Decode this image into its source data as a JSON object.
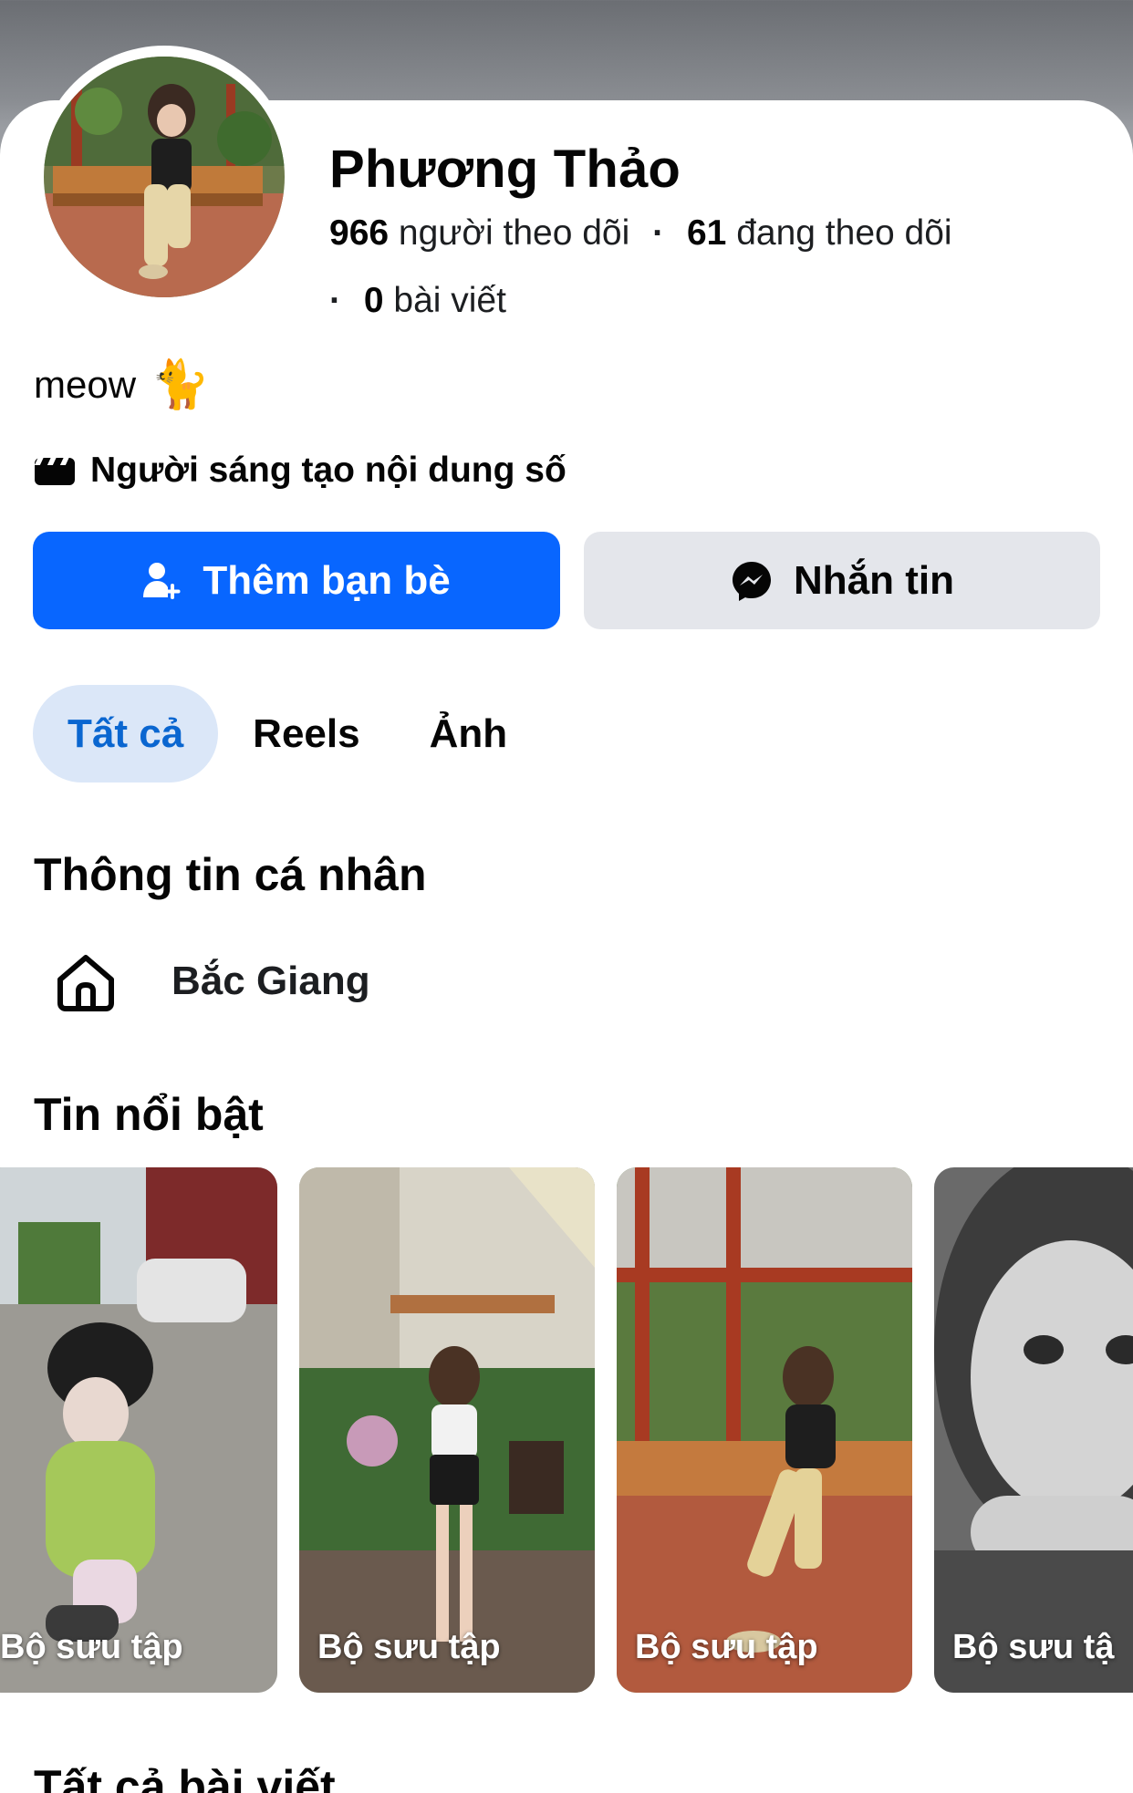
{
  "profile": {
    "name": "Phương Thảo",
    "followers_count": "966",
    "followers_label": "người theo dõi",
    "following_count": "61",
    "following_label": "đang theo dõi",
    "posts_count": "0",
    "posts_label": "bài viết",
    "separator": "·",
    "bio_text": "meow",
    "bio_emoji": "🐈",
    "creator_label": "Người sáng tạo nội dung số"
  },
  "actions": {
    "add_friend_label": "Thêm bạn bè",
    "message_label": "Nhắn tin"
  },
  "tabs": [
    {
      "label": "Tất cả",
      "active": true
    },
    {
      "label": "Reels",
      "active": false
    },
    {
      "label": "Ảnh",
      "active": false
    }
  ],
  "sections": {
    "info_title": "Thông tin cá nhân",
    "hometown": "Bắc Giang",
    "highlights_title": "Tin nổi bật",
    "all_posts_title": "Tất cả bài viết"
  },
  "highlights": [
    {
      "label": "Bộ sưu tập"
    },
    {
      "label": "Bộ sưu tập"
    },
    {
      "label": "Bộ sưu tập"
    },
    {
      "label": "Bộ sưu tậ"
    }
  ],
  "colors": {
    "primary_blue": "#0866ff",
    "secondary_gray": "#e4e6eb",
    "active_tab_bg": "#dbe7f8",
    "active_tab_text": "#0a66d0"
  },
  "icons": {
    "add_friend": "add-person-icon",
    "message": "messenger-icon",
    "creator": "clapperboard-icon",
    "hometown": "home-icon"
  }
}
